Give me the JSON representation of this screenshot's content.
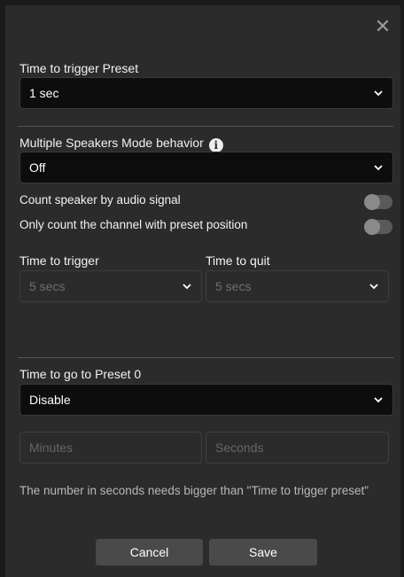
{
  "dialog": {
    "close_glyph": "✕",
    "preset_trigger": {
      "label": "Time to trigger Preset",
      "value": "1 sec"
    },
    "multi_speaker": {
      "label": "Multiple Speakers Mode behavior",
      "info_glyph": "i",
      "value": "Off"
    },
    "toggles": [
      {
        "label": "Count speaker by audio signal",
        "on": false
      },
      {
        "label": "Only count the channel with preset position",
        "on": false
      }
    ],
    "time_to_trigger": {
      "label": "Time to trigger",
      "value": "5 secs"
    },
    "time_to_quit": {
      "label": "Time to quit",
      "value": "5 secs"
    },
    "preset0": {
      "label": "Time to go to Preset 0",
      "value": "Disable"
    },
    "minutes_placeholder": "Minutes",
    "seconds_placeholder": "Seconds",
    "hint": "The number in seconds needs bigger than \"Time to trigger preset\"",
    "cancel_label": "Cancel",
    "save_label": "Save"
  },
  "colors": {
    "modal_bg": "#2b2b2b",
    "select_bg": "#0d0d0d",
    "button_bg": "#4a4a4a"
  }
}
